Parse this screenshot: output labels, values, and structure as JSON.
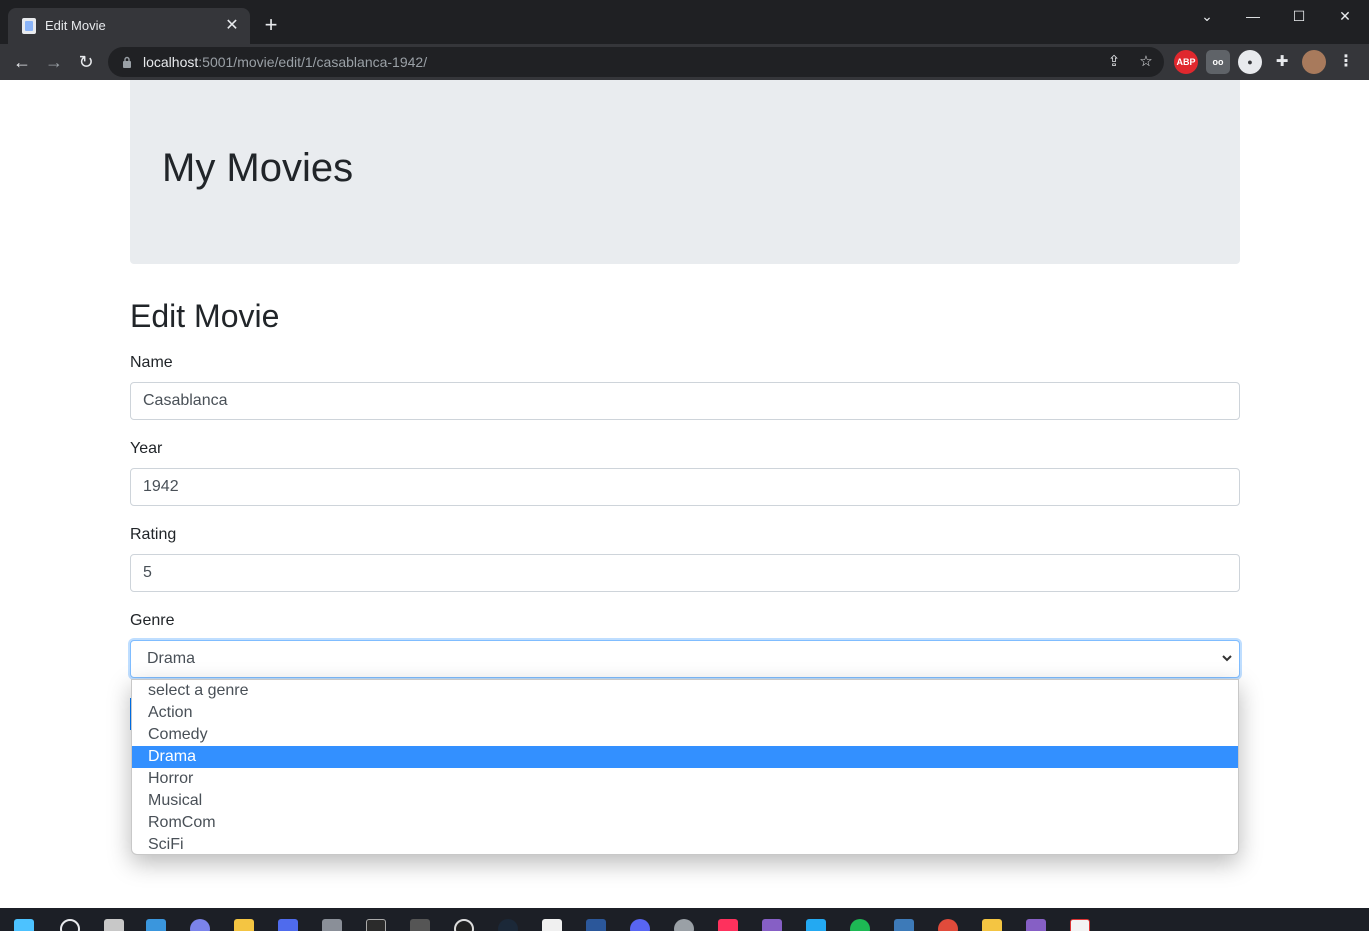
{
  "browser": {
    "tab_title": "Edit Movie",
    "url_host": "localhost",
    "url_rest": ":5001/movie/edit/1/casablanca-1942/",
    "extension_abp_label": "ABP"
  },
  "page": {
    "site_title": "My Movies",
    "heading": "Edit Movie",
    "form": {
      "name_label": "Name",
      "name_value": "Casablanca",
      "year_label": "Year",
      "year_value": "1942",
      "rating_label": "Rating",
      "rating_value": "5",
      "genre_label": "Genre",
      "genre_value": "Drama",
      "genre_options": [
        "select a genre",
        "Action",
        "Comedy",
        "Drama",
        "Horror",
        "Musical",
        "RomCom",
        "SciFi"
      ],
      "genre_selected_index": 3
    }
  },
  "colors": {
    "accent": "#3390ff",
    "jumbotron_bg": "#e9ecef",
    "chrome_bg": "#35363a"
  }
}
